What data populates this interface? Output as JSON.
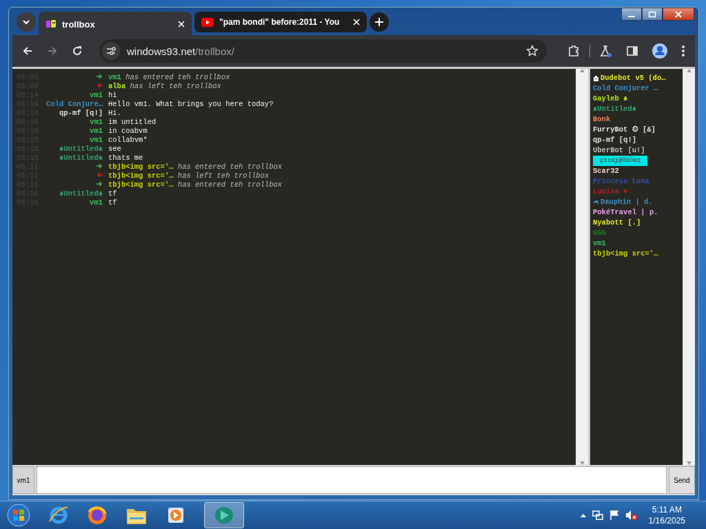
{
  "tabs": [
    {
      "title": "trollbox",
      "selected": true
    },
    {
      "title": "\"pam bondi\" before:2011 - You",
      "selected": false
    }
  ],
  "address": {
    "domain": "windows93.net",
    "path": "/trollbox/"
  },
  "messages": [
    {
      "time": "05:08",
      "kind": "join",
      "nick": "vm1",
      "color": "#3dbb5e",
      "text": "has entered teh trollbox"
    },
    {
      "time": "05:09",
      "kind": "leave",
      "nick": "alba",
      "color": "#b5e61d",
      "text": "has left teh trollbox"
    },
    {
      "time": "05:14",
      "kind": "message",
      "nick": "vm1",
      "color": "#3dbb5e",
      "text": "hi"
    },
    {
      "time": "05:14",
      "kind": "message",
      "nick": "Cold Conjure…",
      "color": "#3a8fc9",
      "text": "Hello vm1. What brings you here today?"
    },
    {
      "time": "05:14",
      "kind": "message",
      "nick": "qp-mf [q!]",
      "color": "#dddddd",
      "text": "Hi."
    },
    {
      "time": "05:15",
      "kind": "message",
      "nick": "vm1",
      "color": "#3dbb5e",
      "text": "im untitled"
    },
    {
      "time": "05:15",
      "kind": "message",
      "nick": "vm1",
      "color": "#3dbb5e",
      "text": "in coabvm"
    },
    {
      "time": "05:15",
      "kind": "message",
      "nick": "vm1",
      "color": "#3dbb5e",
      "text": "collabvm*"
    },
    {
      "time": "05:15",
      "kind": "message",
      "nick": "♣Untitled♣",
      "color": "#35a06a",
      "text": "see"
    },
    {
      "time": "05:15",
      "kind": "message",
      "nick": "♣Untitled♣",
      "color": "#35a06a",
      "text": "thats me"
    },
    {
      "time": "05:11",
      "kind": "join",
      "nick": "tbjb<img src='…",
      "color": "#c8d400",
      "text": "has entered teh trollbox"
    },
    {
      "time": "05:11",
      "kind": "leave",
      "nick": "tbjb<img src='…",
      "color": "#c8d400",
      "text": "has left teh trollbox"
    },
    {
      "time": "05:11",
      "kind": "join",
      "nick": "tbjb<img src='…",
      "color": "#c8d400",
      "text": "has entered teh trollbox"
    },
    {
      "time": "05:16",
      "kind": "message",
      "nick": "♣Untitled♣",
      "color": "#35a06a",
      "text": "tf"
    },
    {
      "time": "05:16",
      "kind": "message",
      "nick": "vm1",
      "color": "#3dbb5e",
      "text": "tf"
    }
  ],
  "users": [
    {
      "name": "Dudebot v5 (do…",
      "color": "#e6e62e",
      "kind": "bot"
    },
    {
      "name": "Cold Conjurer …",
      "color": "#3a8fc9",
      "kind": "plain"
    },
    {
      "name": "Gayleb ♣",
      "color": "#b5e61d",
      "kind": "plain"
    },
    {
      "name": "♣Untitled♣",
      "color": "#35a06a",
      "kind": "plain"
    },
    {
      "name": "Bonk",
      "color": "#e8875a",
      "kind": "plain"
    },
    {
      "name": "FurryBot ⏲ [&]",
      "color": "#e0e0e0",
      "kind": "plain"
    },
    {
      "name": "qp-mf [q!]",
      "color": "#e0e0e0",
      "kind": "plain"
    },
    {
      "name": "UberBot [u!]",
      "color": "#bbbbbb",
      "kind": "plain"
    },
    {
      "name": "ϱɪ±ɷʝ@ßȘȫɯɪ",
      "color": "#00e5e5",
      "kind": "highlight"
    },
    {
      "name": "Scar32",
      "color": "#f0d0c0",
      "kind": "plain"
    },
    {
      "name": "Princess Luna",
      "color": "#3050b0",
      "kind": "plain"
    },
    {
      "name": "Lumina ♥",
      "color": "#b02020",
      "kind": "plain"
    },
    {
      "name": "Dauphin | d.",
      "color": "#3a8fc9",
      "kind": "dolphin"
    },
    {
      "name": "PokéTravel | p.",
      "color": "#e8a0e8",
      "kind": "plain"
    },
    {
      "name": "Nyabott [.]",
      "color": "#e6e62e",
      "kind": "plain"
    },
    {
      "name": "GGG",
      "color": "#1e7a2a",
      "kind": "plain"
    },
    {
      "name": "vm1",
      "color": "#3dbb5e",
      "kind": "plain"
    },
    {
      "name": "tbjb<img src='…",
      "color": "#c8d400",
      "kind": "plain"
    }
  ],
  "input": {
    "nick": "vm1",
    "button": "Send"
  },
  "clock": {
    "time": "5:11 AM",
    "date": "1/16/2025"
  }
}
